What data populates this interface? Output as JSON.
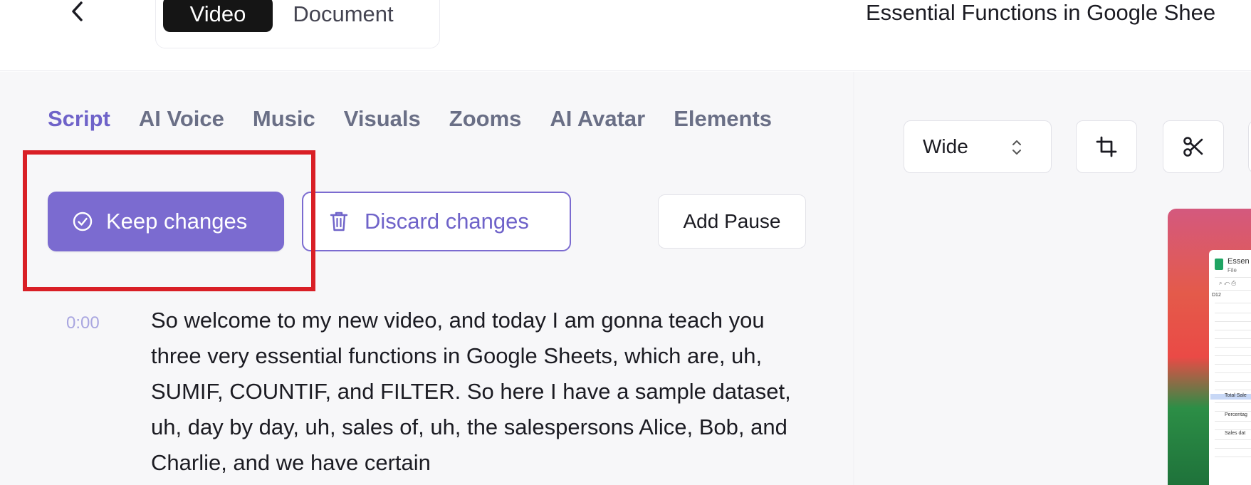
{
  "header": {
    "mode_tabs": [
      "Video",
      "Document"
    ],
    "active_mode": "Video",
    "document_title": "Essential Functions in Google Shee"
  },
  "editor": {
    "tabs": [
      "Script",
      "AI Voice",
      "Music",
      "Visuals",
      "Zooms",
      "AI Avatar",
      "Elements"
    ],
    "active_tab": "Script",
    "keep_changes_label": "Keep changes",
    "discard_changes_label": "Discard changes",
    "add_pause_label": "Add Pause",
    "script": {
      "timestamp": "0:00",
      "text": "So welcome to my new video, and today I am gonna teach you three very essential functions in Google Sheets, which are, uh, SUMIF, COUNTIF, and FILTER. So here I have a sample dataset, uh, day by day, uh, sales of, uh, the salespersons Alice, Bob, and Charlie, and we have certain"
    }
  },
  "preview_panel": {
    "aspect_ratio": "Wide",
    "tools": [
      "crop-icon",
      "scissors-icon"
    ],
    "thumbnail": {
      "sheet_title": "Essen",
      "menu_text": "File",
      "cell_ref": "D12",
      "row_labels": [
        "Total Sale",
        "Percentag",
        "Sales dat"
      ]
    }
  },
  "colors": {
    "accent": "#7b6bd0",
    "active_tab": "#6f63c9",
    "annotation": "#d91f26",
    "timestamp": "#a9a6e0"
  }
}
